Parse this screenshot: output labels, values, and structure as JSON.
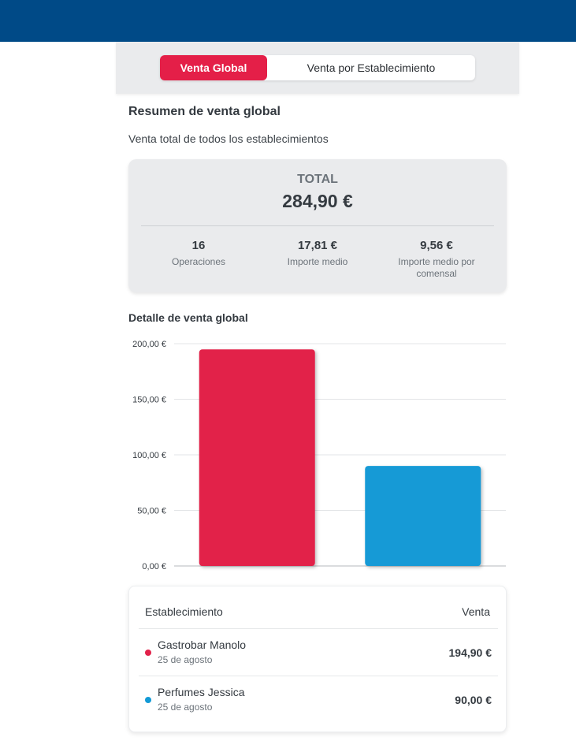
{
  "tabs": {
    "active": "Venta Global",
    "inactive": "Venta por Establecimiento"
  },
  "summary": {
    "title": "Resumen de venta global",
    "subtitle": "Venta total de todos los establecimientos",
    "total_label": "TOTAL",
    "total_value": "284,90 €",
    "stats": [
      {
        "value": "16",
        "label": "Operaciones"
      },
      {
        "value": "17,81 €",
        "label": "Importe medio"
      },
      {
        "value": "9,56 €",
        "label": "Importe medio por comensal"
      }
    ]
  },
  "detail": {
    "title": "Detalle de venta global"
  },
  "chart_data": {
    "type": "bar",
    "categories": [
      "Gastrobar Manolo",
      "Perfumes Jessica"
    ],
    "values": [
      194.9,
      90.0
    ],
    "colors": [
      "#e2224a",
      "#139ad6"
    ],
    "ylim": [
      0,
      200
    ],
    "yticks": [
      0,
      50,
      100,
      150,
      200
    ],
    "ytick_labels": [
      "0,00 €",
      "50,00 €",
      "100,00 €",
      "150,00 €",
      "200,00 €"
    ],
    "grid": true,
    "legend": "none"
  },
  "table": {
    "col_name": "Establecimiento",
    "col_value": "Venta",
    "rows": [
      {
        "name": "Gastrobar Manolo",
        "date": "25 de agosto",
        "value": "194,90 €",
        "color": "#e2224a"
      },
      {
        "name": "Perfumes Jessica",
        "date": "25 de agosto",
        "value": "90,00 €",
        "color": "#139ad6"
      }
    ]
  }
}
